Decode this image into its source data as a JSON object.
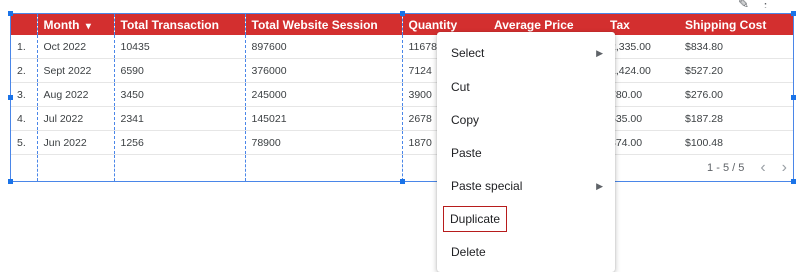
{
  "toolbar": {
    "icons": [
      "pencil-icon",
      "more-vert-icon"
    ]
  },
  "table": {
    "columns": [
      "Month",
      "Total Transaction",
      "Total Website Session",
      "Quantity",
      "Average Price",
      "Tax",
      "Shipping Cost"
    ],
    "sort_indicator": "▾",
    "rows": [
      {
        "idx": "1.",
        "month": "Oct 2022",
        "transaction": "10435",
        "session": "897600",
        "quantity": "11678",
        "avg_price": "",
        "tax": "2,335.00",
        "shipping": "$834.80"
      },
      {
        "idx": "2.",
        "month": "Sept 2022",
        "transaction": "6590",
        "session": "376000",
        "quantity": "7124",
        "avg_price": "",
        "tax": "1,424.00",
        "shipping": "$527.20"
      },
      {
        "idx": "3.",
        "month": "Aug 2022",
        "transaction": "3450",
        "session": "245000",
        "quantity": "3900",
        "avg_price": "",
        "tax": "780.00",
        "shipping": "$276.00"
      },
      {
        "idx": "4.",
        "month": "Jul 2022",
        "transaction": "2341",
        "session": "145021",
        "quantity": "2678",
        "avg_price": "",
        "tax": "535.00",
        "shipping": "$187.28"
      },
      {
        "idx": "5.",
        "month": "Jun 2022",
        "transaction": "1256",
        "session": "78900",
        "quantity": "1870",
        "avg_price": "",
        "tax": "374.00",
        "shipping": "$100.48"
      }
    ],
    "pagination": "1 - 5 / 5",
    "prev_glyph": "‹",
    "next_glyph": "›"
  },
  "context_menu": {
    "items": [
      {
        "label": "Select",
        "submenu": true
      },
      {
        "label": "Cut",
        "submenu": false
      },
      {
        "label": "Copy",
        "submenu": false
      },
      {
        "label": "Paste",
        "submenu": false
      },
      {
        "label": "Paste special",
        "submenu": true
      },
      {
        "label": "Duplicate",
        "submenu": false,
        "highlighted": true
      },
      {
        "label": "Delete",
        "submenu": false
      }
    ],
    "submenu_glyph": "▶"
  },
  "colors": {
    "header_bg": "#d32f2f",
    "selection": "#1a73e8",
    "highlight_border": "#b71c1c"
  }
}
